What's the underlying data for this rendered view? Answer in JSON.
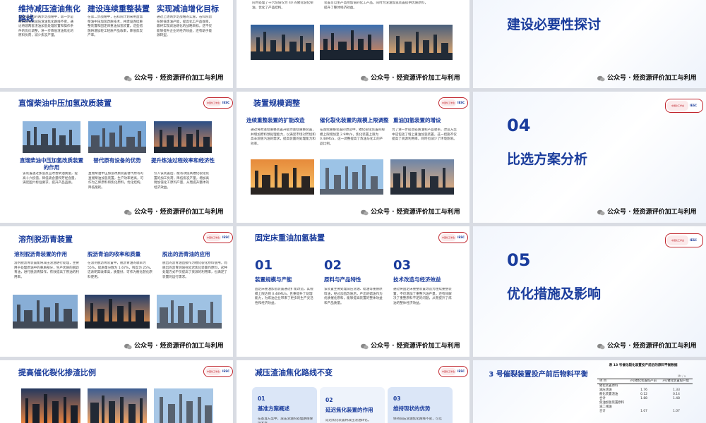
{
  "footer": {
    "label": "公众号 · 烃资源评价加工与利用"
  },
  "logo": {
    "name": "中国化工学会",
    "abbr": "IESC"
  },
  "slides": {
    "s00": {
      "heading": "维持减压渣油焦化路线",
      "text": "石科院提出的两步走战略中，第一步是保持现有的减压渣油焦化路线不变，通过将建两套渣油加氢处理装置和操作条件的优化调整，进一步降低渣油焦化的原料负荷，减少焦炭产量。"
    },
    "s01": {
      "heading": "建设连续重整装置",
      "text": "在第二步战略中，石科院计划采用直馏柴油中压加氢改质技术，并建设连续重整装置和固定床重油加氢装置。这些措施将增加轻工轻质产品收率，降低焦炭产率。"
    },
    "s02": {
      "heading": "实现减油增化目标",
      "text": "通过上述两步走战略的实施，石科院旨在降低炼油产能，提高化工产品收率，最终实现减油增化的战略目标，这不仅能够提升企业的经济效益，还有助于能源转型。"
    },
    "s10": {
      "text": "同时处理了十六烷值仅为 40 的催化裂化柴油，优化了产品结构。"
    },
    "s11": {
      "text": "装置可以生产高附加值的化工产品，同时为渣油加氢装置提供优质原料，提升了整体经济效益。"
    },
    "s12": {
      "title": "建设必要性探讨"
    },
    "s20": {
      "title": "直馏柴油中压加氢改质装置",
      "col1_heading": "直馏柴油中压加氢改质装置的作用",
      "col1_text": "该装置通过加氢反应改善柴油质量，提高十六烷值，降低硫含量和芳烃含量，满足国六标准要求，提升产品品质。",
      "col2_heading": "替代原有设备的优势",
      "col2_text": "直馏柴油中压加氢改质装置替代原有的直馏柴油加氢装置，生产效率更高，可作为乙烯原料和焦化原料，优化结构，降低能耗。",
      "col3_heading": "提升炼油过程效率和经济性",
      "col3_text": "引入该装置后，能有效提高催化裂化装置的加工负荷，降低焦炭产量，增加高附加值化工原料产量，从而提升整体的经济效益。"
    },
    "s21": {
      "title": "装置规模调整",
      "col1_heading": "连续重整装置的扩能改造",
      "col1_text": "通过将原连续重整装置升级为连续重整装置，并增加原料预处理能力，以满足市场对芳烃和高辛烷值汽油的需求，提高装置的处理能力和效率。",
      "col2_heading": "催化裂化装置的规模上限调整",
      "col2_text": "在连续重整装置的改造中，催化裂化装置的规模上限增加至 2.9Mt/a，焦化装置上限为 0.48Mt/a，这一调整提高了炼油与化工的产品比例。",
      "col3_heading": "重油加氢装置的增设",
      "col3_text": "为了进一步提高轻质油和产品收率，改造方案中还包括了增上重油加氢装置，这一措施不仅提高了资源利用率，同时也减少了环境影响。"
    },
    "s22": {
      "num": "04",
      "title": "比选方案分析"
    },
    "s30": {
      "title": "溶剂脱沥青装置",
      "col1_heading": "溶剂脱沥青装置的作用",
      "col1_text": "溶剂脱沥青装置能将减压渣油进行处理，主要用于处理原油中的重质部分，生产优质的脱沥青油，进行脱沥青操作，有效提高了原油的利用率。",
      "col2_heading": "脱沥青油的收率和质量",
      "col2_text": "在溶剂脱沥青装置中，脱沥青油的收率为 55%，硫质量分数为 1.67%，残炭为 25%，这表明其收率高，质量好，可作为催化裂化原料使用。",
      "col3_heading": "脱出的沥青油的应用",
      "col3_text": "脱出的沥青油直接作为催化裂化原料使用，而脱出的沥青则送往延迟焦化装置作原料，这种处理方式不仅提高了资源的利用率，也满足了装置的运行需求。"
    },
    "s31": {
      "title": "固定床重油加氢装置",
      "n1": "01",
      "h1": "装置规模与产能",
      "t1": "固定床重油加氢装置通过扩能改造，其规模上限达到 0.48Mt/a，且重提升了处理能力，为炼油企业带来了更多的生产灵活性和经济效益。",
      "n2": "02",
      "h2": "原料与产品特性",
      "t2": "该装置主要处理减压渣油、蜡油等重质原料油，经过加氢改质后，产出的蜡油作为优质催化原料，能够提高装置的整体效益和产品质量。",
      "n3": "03",
      "h3": "技术改造与经济效益",
      "t3": "通过将固定床重整装置改造为连续重整装置，不仅增加了重整汽油产量，还有效解决了重整原料不足的问题，从而提升了炼油的整体经济效益。"
    },
    "s32": {
      "num": "05",
      "title": "优化措施及影响"
    },
    "s40": {
      "title": "提高催化裂化掺渣比例"
    },
    "s41": {
      "title": "减压渣油焦化路线不变",
      "n1": "01",
      "h1": "基准方案概述",
      "t1": "在基准方案中，减压渣油的处理路线保持不变。",
      "n2": "02",
      "h2": "延迟焦化装置的作用",
      "t2": "延迟焦化装置将减压渣油转化。",
      "n3": "03",
      "h3": "维持现状的优势",
      "t3": "保持减压渣油焦化路线不变，可以"
    },
    "s42": {
      "title": "3 号催裂装置投产前后物料平衡",
      "table_caption": "表 13 号催化裂化装置投产前后的原料平衡数据",
      "unit": "Mt / a",
      "col_item": "项 目",
      "col_before": "3号催化装置投产前",
      "col_after": "3号催化装置投产后",
      "rows": [
        {
          "item": "催化装置原料",
          "before": "",
          "after": ""
        },
        {
          "item": "减压渣油",
          "before": "1.76",
          "after": "1.33"
        },
        {
          "item": "催化装置渣油",
          "before": "0.12",
          "after": "0.14"
        },
        {
          "item": "合计",
          "before": "1.88",
          "after": "1.48"
        },
        {
          "item": "焦油加氢装置原料",
          "before": "",
          "after": ""
        },
        {
          "item": "减二线油",
          "before": "",
          "after": ""
        },
        {
          "item": "合计",
          "before": "1.07",
          "after": "1.07"
        }
      ]
    }
  }
}
